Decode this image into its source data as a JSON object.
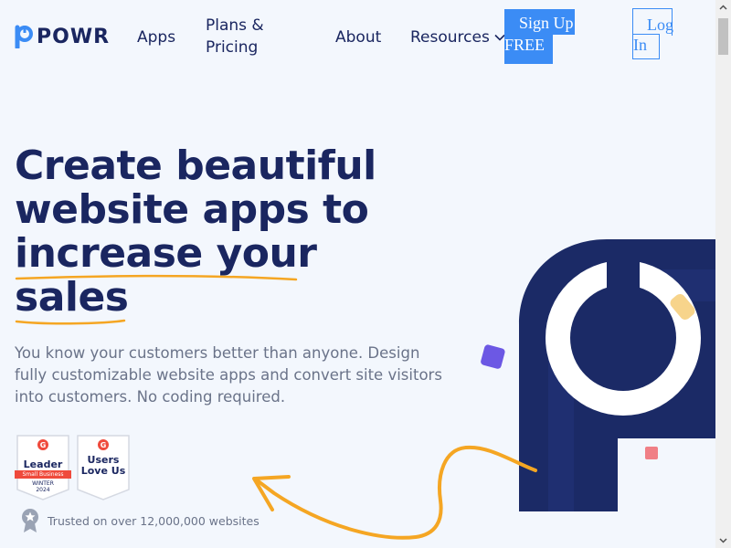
{
  "nav": {
    "logo_text": "POWR",
    "apps": "Apps",
    "plans": "Plans & Pricing",
    "about": "About",
    "resources": "Resources",
    "signup_line1": "Sign Up",
    "signup_line2": "FREE",
    "login_line1": "Log",
    "login_line2": "In"
  },
  "hero": {
    "headline_1": "Create beautiful",
    "headline_2": "website apps to",
    "headline_3": "increase your",
    "headline_4": "sales",
    "subtext": "You know your customers better than anyone. Design fully customizable website apps and convert site visitors into customers. No coding required."
  },
  "badges": {
    "leader_title": "Leader",
    "leader_ribbon": "Small Business",
    "leader_season": "WINTER",
    "leader_year": "2024",
    "users_title_1": "Users",
    "users_title_2": "Love Us"
  },
  "trusted": {
    "text": "Trusted on over 12,000,000 websites"
  },
  "colors": {
    "brand_navy": "#1a2660",
    "accent_blue": "#3b8cf5",
    "highlight_orange": "#f5a623",
    "g2_red": "#ef4a3c"
  },
  "icons": {
    "logo": "powr-logo-icon",
    "resources_chevron": "chevron-down-icon",
    "medal": "medal-icon"
  }
}
